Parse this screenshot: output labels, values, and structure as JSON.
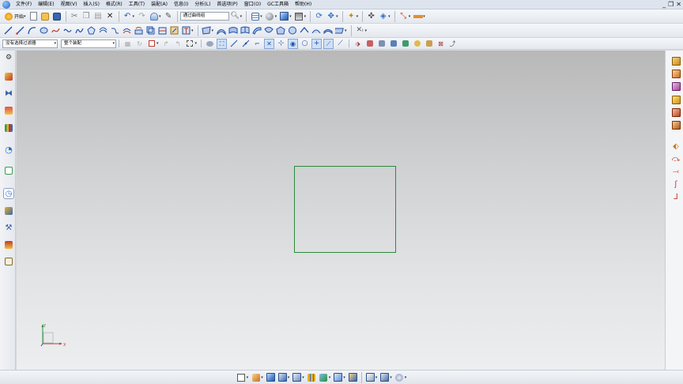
{
  "menubar": {
    "items": [
      "文件(F)",
      "编辑(E)",
      "视图(V)",
      "插入(S)",
      "格式(R)",
      "工具(T)",
      "装配(A)",
      "信息(I)",
      "分析(L)",
      "首选项(P)",
      "窗口(O)",
      "GC工具箱",
      "帮助(H)"
    ],
    "window_controls": [
      "_",
      "❐",
      "✕"
    ]
  },
  "toolbar1": {
    "start_label": "开始",
    "curve_rule_value": "通过曲线组"
  },
  "toolbar3": {
    "selection_filter_value": "没有选择过滤器",
    "selection_scope_value": "整个装配"
  },
  "colors": {
    "viewport_top": "#b8b8b8",
    "viewport_bottom": "#eceef0",
    "sketch_line": "#2a8c3a",
    "accent_blue": "#2f6fc5"
  },
  "icons": {
    "left_sidebar": [
      "resource-bar-settings-icon",
      "assembly-navigator-icon",
      "constraint-navigator-icon",
      "part-navigator-icon",
      "library-icon",
      "web-browser-icon",
      "history-icon",
      "system-materials-icon",
      "process-studio-icon",
      "manufacturing-wizard-icon",
      "roles-icon"
    ],
    "right_sidebar": [
      "extrude-icon",
      "revolve-icon",
      "block-icon",
      "cylinder-icon",
      "sphere-icon",
      "offset-surface-icon",
      "trim-body-icon",
      "split-body-icon",
      "curve-on-surface-icon",
      "project-curve-icon"
    ]
  },
  "triad": {
    "x_label": "X",
    "y_label": "Y"
  }
}
